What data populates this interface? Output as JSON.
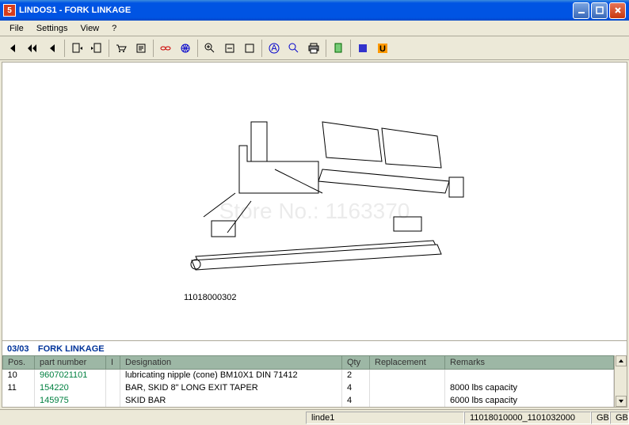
{
  "window": {
    "icon_label": "5",
    "title": "LINDOS1 - FORK LINKAGE"
  },
  "menu": {
    "file": "File",
    "settings": "Settings",
    "view": "View",
    "help": "?"
  },
  "section": {
    "number": "03/03",
    "title": "FORK LINKAGE"
  },
  "diagram": {
    "ref": "11018000302"
  },
  "table": {
    "headers": {
      "pos": "Pos.",
      "partnum": "part number",
      "i": "I",
      "designation": "Designation",
      "qty": "Qty",
      "replacement": "Replacement",
      "remarks": "Remarks"
    },
    "rows": [
      {
        "pos": "10",
        "partnum": "9607021101",
        "i": "",
        "designation": "lubricating nipple (cone) BM10X1  DIN 71412",
        "qty": "2",
        "replacement": "",
        "remarks": ""
      },
      {
        "pos": "11",
        "partnum": "154220",
        "i": "",
        "designation": "BAR, SKID 8\" LONG EXIT TAPER",
        "qty": "4",
        "replacement": "",
        "remarks": "8000 lbs capacity"
      },
      {
        "pos": "",
        "partnum": "145975",
        "i": "",
        "designation": "SKID BAR",
        "qty": "4",
        "replacement": "",
        "remarks": "6000 lbs capacity"
      }
    ]
  },
  "status": {
    "left": "linde1",
    "code": "11018010000_1101032000",
    "lang1": "GB",
    "lang2": "GB"
  },
  "watermark": "Store No.: 1163370"
}
